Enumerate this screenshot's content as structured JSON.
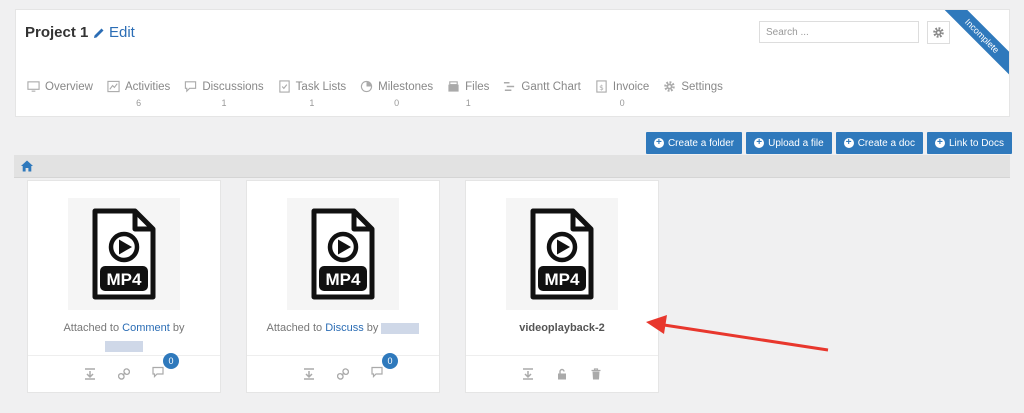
{
  "project": {
    "title": "Project 1",
    "edit_label": "Edit",
    "status_ribbon": "Incomplete"
  },
  "search": {
    "placeholder": "Search ..."
  },
  "nav": [
    {
      "label": "Overview",
      "count": "",
      "icon": "overview-icon"
    },
    {
      "label": "Activities",
      "count": "6",
      "icon": "activities-icon"
    },
    {
      "label": "Discussions",
      "count": "1",
      "icon": "discussions-icon"
    },
    {
      "label": "Task Lists",
      "count": "1",
      "icon": "task-lists-icon"
    },
    {
      "label": "Milestones",
      "count": "0",
      "icon": "milestones-icon"
    },
    {
      "label": "Files",
      "count": "1",
      "icon": "files-icon"
    },
    {
      "label": "Gantt Chart",
      "count": "",
      "icon": "gantt-chart-icon"
    },
    {
      "label": "Invoice",
      "count": "0",
      "icon": "invoice-icon"
    },
    {
      "label": "Settings",
      "count": "",
      "icon": "settings-icon"
    }
  ],
  "toolbar": {
    "create_folder": "Create a folder",
    "upload_file": "Upload a file",
    "create_doc": "Create a doc",
    "link_docs": "Link to Docs"
  },
  "files": [
    {
      "type_label": "MP4",
      "attached_prefix": "Attached to",
      "attached_link": "Comment",
      "attached_by": "by",
      "comment_count": "0"
    },
    {
      "type_label": "MP4",
      "attached_prefix": "Attached to",
      "attached_link": "Discuss",
      "attached_by": "by",
      "comment_count": "0"
    },
    {
      "type_label": "MP4",
      "title": "videoplayback-2"
    }
  ],
  "colors": {
    "accent": "#2f79bc",
    "arrow": "#e8372d",
    "link": "#2b6db5"
  }
}
